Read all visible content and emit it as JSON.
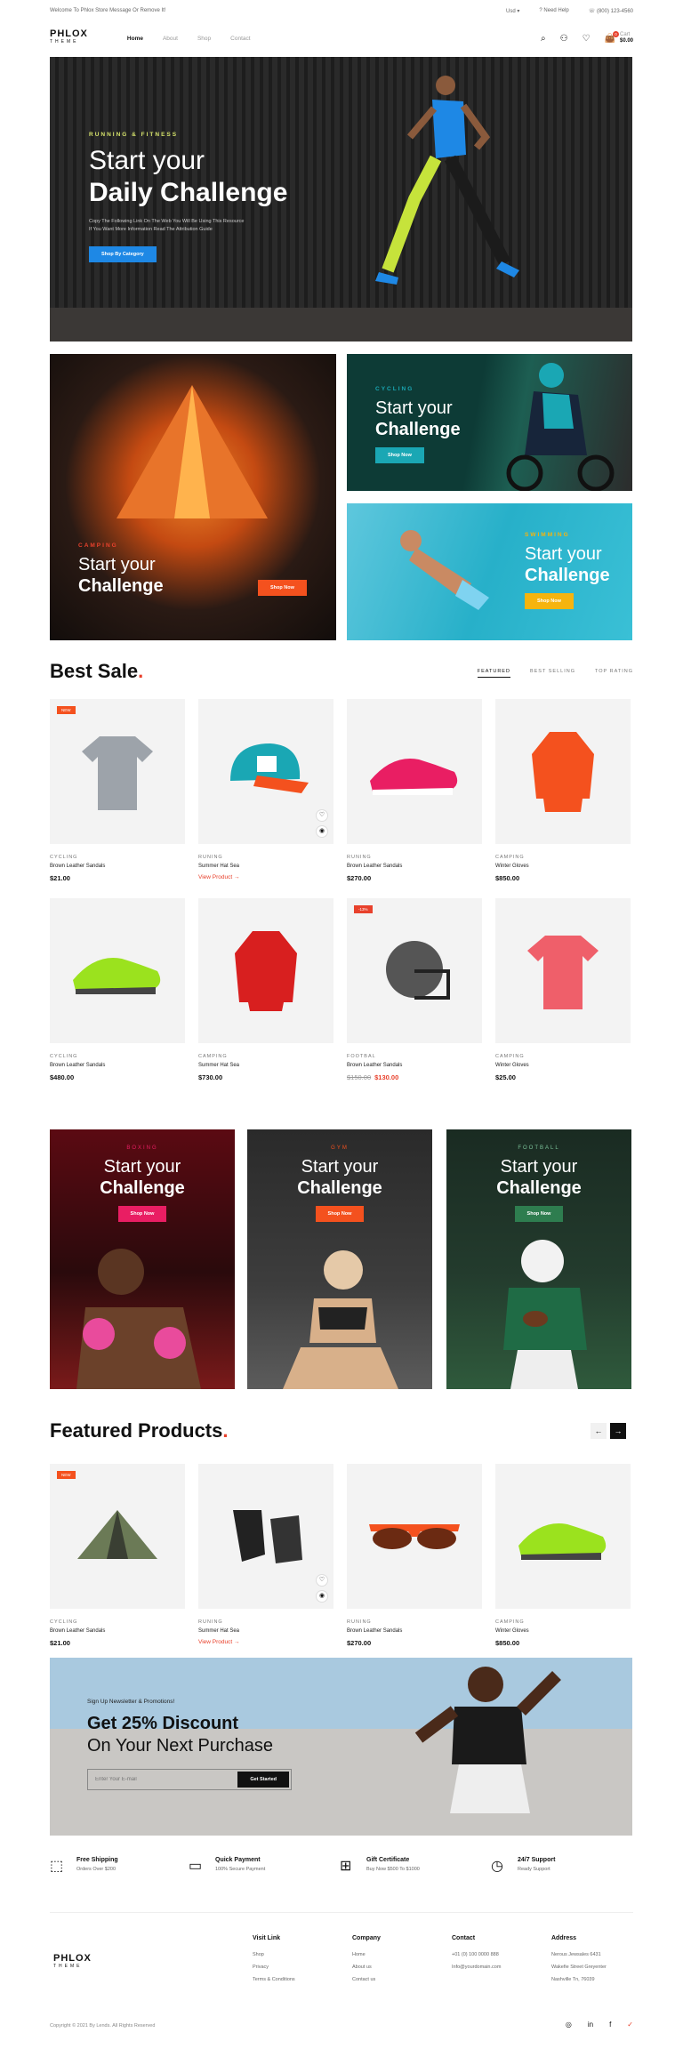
{
  "topbar": {
    "welcome": "Welcome To Phlox Store Message Or Remove It!",
    "currency": "Usd",
    "help": "Need Help",
    "phone": "(800) 123-4560"
  },
  "header": {
    "logo": "PHLOX",
    "logo_sub": "THEME",
    "nav": [
      "Home",
      "About",
      "Shop",
      "Contact"
    ],
    "cart_label": "Cart",
    "cart_amount": "$0.00",
    "cart_count": "0"
  },
  "hero": {
    "kicker": "RUNNING & FITNESS",
    "title1": "Start your",
    "title2": "Daily Challenge",
    "desc1": "Copy The Following Link On The Web You Will Be Using This Resource",
    "desc2": "If You Want More Information Read The Attribution Guide",
    "button": "Shop By Category"
  },
  "banners": {
    "camping": {
      "kicker": "CAMPING",
      "t1": "Start your",
      "t2": "Challenge",
      "button": "Shop Now"
    },
    "cycling": {
      "kicker": "CYCLING",
      "t1": "Start your",
      "t2": "Challenge",
      "button": "Shop Now"
    },
    "swimming": {
      "kicker": "SWIMMING",
      "t1": "Start your",
      "t2": "Challenge",
      "button": "Shop Now"
    }
  },
  "best_sale": {
    "title": "Best Sale",
    "tabs": [
      "FEATURED",
      "BEST SELLING",
      "TOP RATING"
    ],
    "products": [
      {
        "cat": "CYCLING",
        "name": "Brown Leather Sandals",
        "price": "$21.00",
        "tag": "NEW"
      },
      {
        "cat": "RUNING",
        "name": "Summer Hat Sea",
        "link": "View Product →"
      },
      {
        "cat": "RUNING",
        "name": "Brown Leather Sandals",
        "price": "$270.00"
      },
      {
        "cat": "CAMPING",
        "name": "Winter Gloves",
        "price": "$850.00"
      },
      {
        "cat": "CYCLING",
        "name": "Brown Leather Sandals",
        "price": "$480.00"
      },
      {
        "cat": "CAMPING",
        "name": "Summer Hat Sea",
        "price": "$730.00"
      },
      {
        "cat": "FOOTBAL",
        "name": "Brown Leather Sandals",
        "old": "$150.00",
        "price": "$130.00",
        "tag": "-13%"
      },
      {
        "cat": "CAMPING",
        "name": "Winter Gloves",
        "price": "$25.00"
      }
    ]
  },
  "sports": [
    {
      "kicker": "BOXING",
      "t1": "Start your",
      "t2": "Challenge",
      "button": "Shop Now"
    },
    {
      "kicker": "GYM",
      "t1": "Start your",
      "t2": "Challenge",
      "button": "Shop Now"
    },
    {
      "kicker": "FOOTBALL",
      "t1": "Start your",
      "t2": "Challenge",
      "button": "Shop Now"
    }
  ],
  "featured": {
    "title": "Featured Products",
    "prev": "←",
    "next": "→",
    "products": [
      {
        "cat": "CYCLING",
        "name": "Brown Leather Sandals",
        "price": "$21.00",
        "tag": "NEW"
      },
      {
        "cat": "RUNING",
        "name": "Summer Hat Sea",
        "link": "View Product →"
      },
      {
        "cat": "RUNING",
        "name": "Brown Leather Sandals",
        "price": "$270.00"
      },
      {
        "cat": "CAMPING",
        "name": "Winter Gloves",
        "price": "$850.00"
      }
    ]
  },
  "newsletter": {
    "kicker": "Sign Up Newsletter & Promotions!",
    "title1": "Get 25% Discount",
    "title2": "On Your Next Purchase",
    "placeholder": "Enter Your E-mail",
    "button": "Get Started"
  },
  "features": [
    {
      "title": "Free Shipping",
      "sub": "Orders Over $200"
    },
    {
      "title": "Quick Payment",
      "sub": "100% Secure Payment"
    },
    {
      "title": "Gift Certificate",
      "sub": "Buy Now $500 To $1000"
    },
    {
      "title": "24/7 Support",
      "sub": "Ready Support"
    }
  ],
  "footer": {
    "logo": "PHLOX",
    "logo_sub": "THEME",
    "cols": [
      {
        "h": "Visit Link",
        "links": [
          "Shop",
          "Privacy",
          "Terms & Conditions"
        ]
      },
      {
        "h": "Company",
        "links": [
          "Home",
          "About us",
          "Contact us"
        ]
      },
      {
        "h": "Contact",
        "links": [
          "+01 (0) 100 0000 888",
          "Info@yourdomain.com"
        ]
      },
      {
        "h": "Address",
        "links": [
          "Nerous Jewsales 6431",
          "Wakefie Street Greyenter",
          "Nashville Tn, 76039"
        ]
      }
    ],
    "copyright": "Copyright © 2021 By Lends. All Rights Reserved",
    "social": [
      "◎",
      "in",
      "f",
      "✓"
    ]
  },
  "colors": {
    "accent": "#e8412c",
    "blue": "#1e88e5",
    "orange": "#f4511e",
    "teal": "#1aa7b4",
    "yellow": "#f6b40e",
    "pink": "#e91e63",
    "green": "#2e7d4f"
  }
}
